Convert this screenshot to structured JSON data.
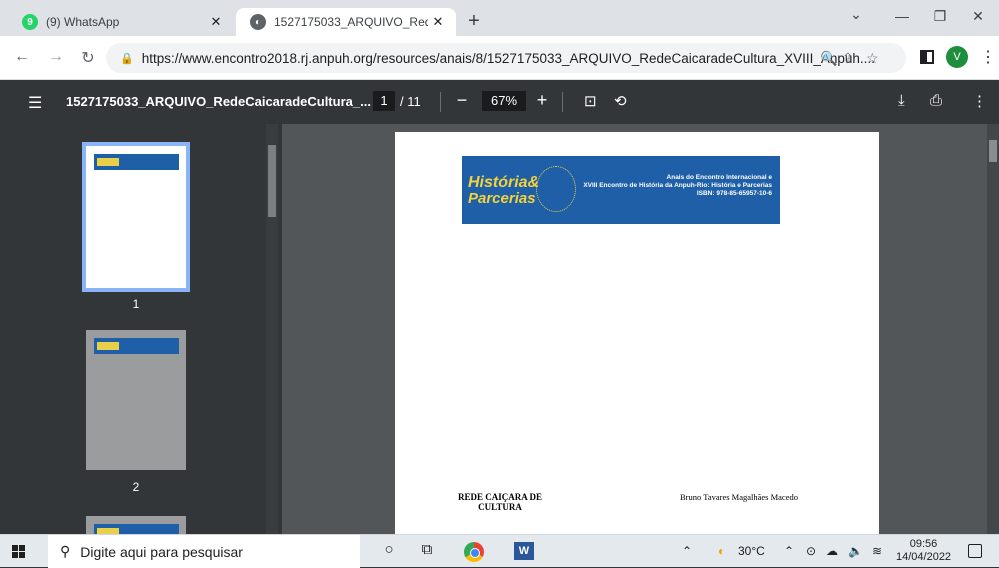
{
  "browser": {
    "tabs": [
      {
        "title": "(9) WhatsApp",
        "badge": "9",
        "favicon_color": "#25d366",
        "active": false
      },
      {
        "title": "1527175033_ARQUIVO_RedeCaic",
        "favicon_color": "#5f6368",
        "active": true
      }
    ],
    "new_tab": "+",
    "window_controls": {
      "minimize": "—",
      "maximize": "❐",
      "close": "✕"
    },
    "url": "https://www.encontro2018.rj.anpuh.org/resources/anais/8/1527175033_ARQUIVO_RedeCaicaradeCultura_XVIII_Anpuh....",
    "profile_initial": "V"
  },
  "pdf": {
    "filename": "1527175033_ARQUIVO_RedeCaicaradeCultura_...",
    "current_page": "1",
    "total_pages": "/ 11",
    "zoom": "67%",
    "thumbnails": [
      {
        "label": "1",
        "selected": true
      },
      {
        "label": "2",
        "selected": false
      }
    ],
    "page": {
      "banner_title_1": "História&",
      "banner_title_2": "Parcerias",
      "banner_line1": "Anais do Encontro Internacional e",
      "banner_line2": "XVIII Encontro de História da Anpuh-Rio: História e Parcerias",
      "banner_line3": "ISBN: 978-85-65957-10-6",
      "doc_title": "REDE CAIÇARA DE CULTURA",
      "author": "Bruno Tavares Magalhães Macedo"
    }
  },
  "taskbar": {
    "search_placeholder": "Digite aqui para pesquisar",
    "temperature": "30°C",
    "time": "09:56",
    "date": "14/04/2022"
  }
}
